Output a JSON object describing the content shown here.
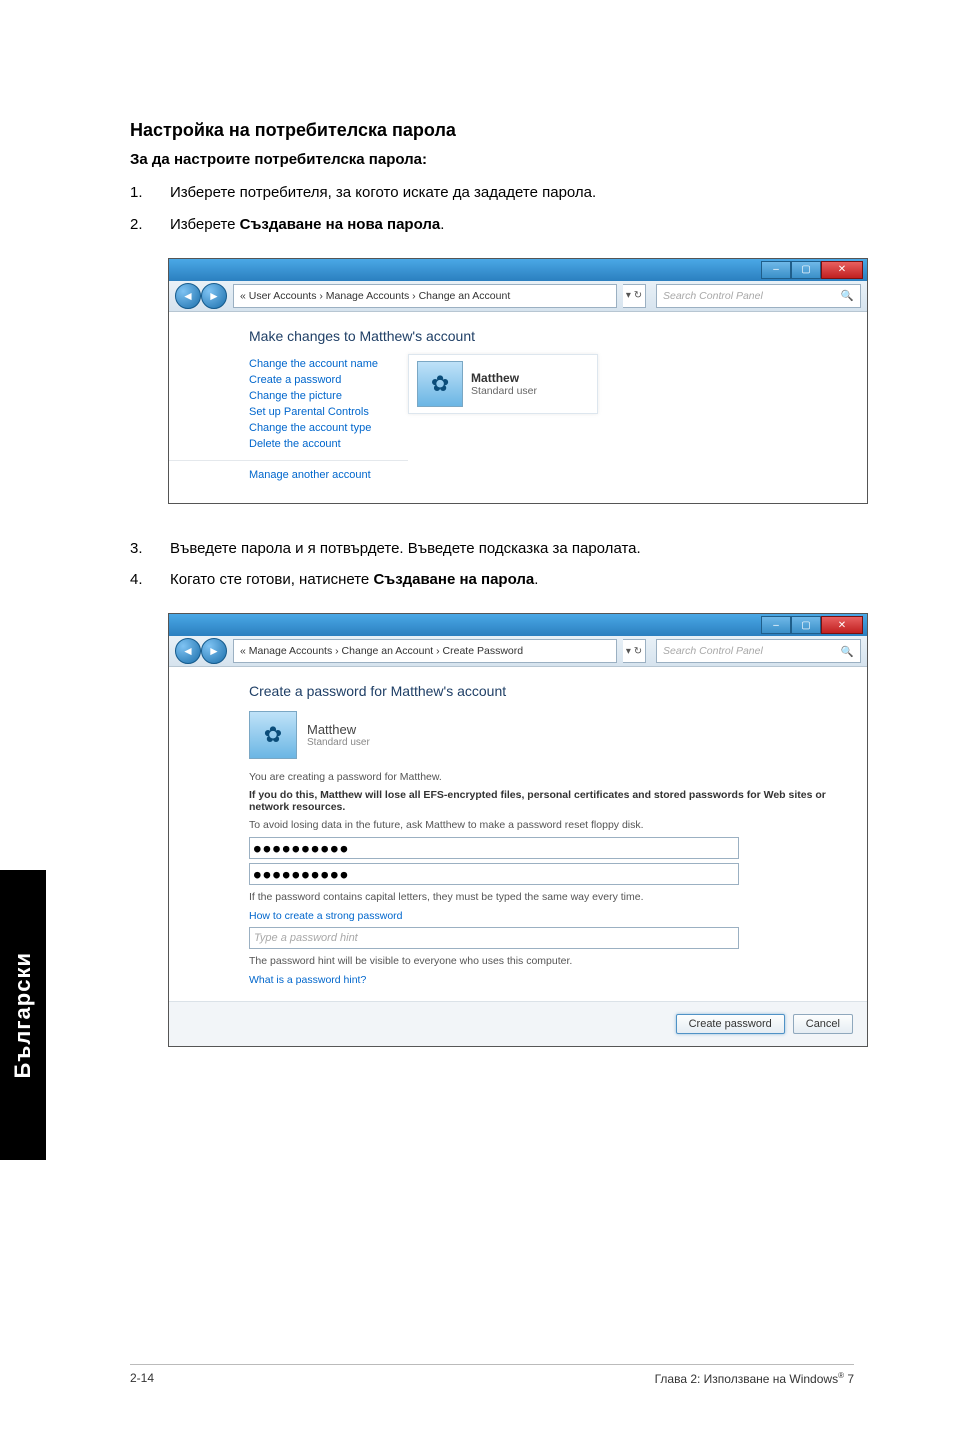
{
  "title": "Настройка на потребителска парола",
  "subtitle": "За да настроите потребителска парола:",
  "steps1": [
    {
      "num": "1.",
      "text": "Изберете потребителя, за когото искате да зададете парола."
    },
    {
      "num": "2.",
      "pre": "Изберете ",
      "bold": "Създаване на нова парола",
      "post": "."
    }
  ],
  "steps2": [
    {
      "num": "3.",
      "text": "Въведете парола и я потвърдете. Въведете подсказка за паролата."
    },
    {
      "num": "4.",
      "pre": "Когато сте готови, натиснете ",
      "bold": "Създаване на парола",
      "post": "."
    }
  ],
  "shot1": {
    "crumb": "« User Accounts › Manage Accounts › Change an Account",
    "search_ph": "Search Control Panel",
    "heading": "Make changes to Matthew's account",
    "links": [
      "Change the account name",
      "Create a password",
      "Change the picture",
      "Set up Parental Controls",
      "Change the account type",
      "Delete the account",
      "Manage another account"
    ],
    "user_name": "Matthew",
    "user_sub": "Standard user"
  },
  "shot2": {
    "crumb": "« Manage Accounts › Change an Account › Create Password",
    "search_ph": "Search Control Panel",
    "heading": "Create a password for Matthew's account",
    "user_name": "Matthew",
    "user_sub": "Standard user",
    "line_creating": "You are creating a password for Matthew.",
    "warn": "If you do this, Matthew will lose all EFS-encrypted files, personal certificates and stored passwords for Web sites or network resources.",
    "advice": "To avoid losing data in the future, ask Matthew to make a password reset floppy disk.",
    "pw_value": "●●●●●●●●●●",
    "caps_note": "If the password contains capital letters, they must be typed the same way every time.",
    "link_strong": "How to create a strong password",
    "hint_ph": "Type a password hint",
    "hint_note": "The password hint will be visible to everyone who uses this computer.",
    "link_hint": "What is a password hint?",
    "btn_create": "Create password",
    "btn_cancel": "Cancel"
  },
  "side_tab": "Български",
  "footer_left": "2-14",
  "footer_right_pre": "Глава 2: Използване на Windows",
  "footer_right_sup": "®",
  "footer_right_post": " 7"
}
